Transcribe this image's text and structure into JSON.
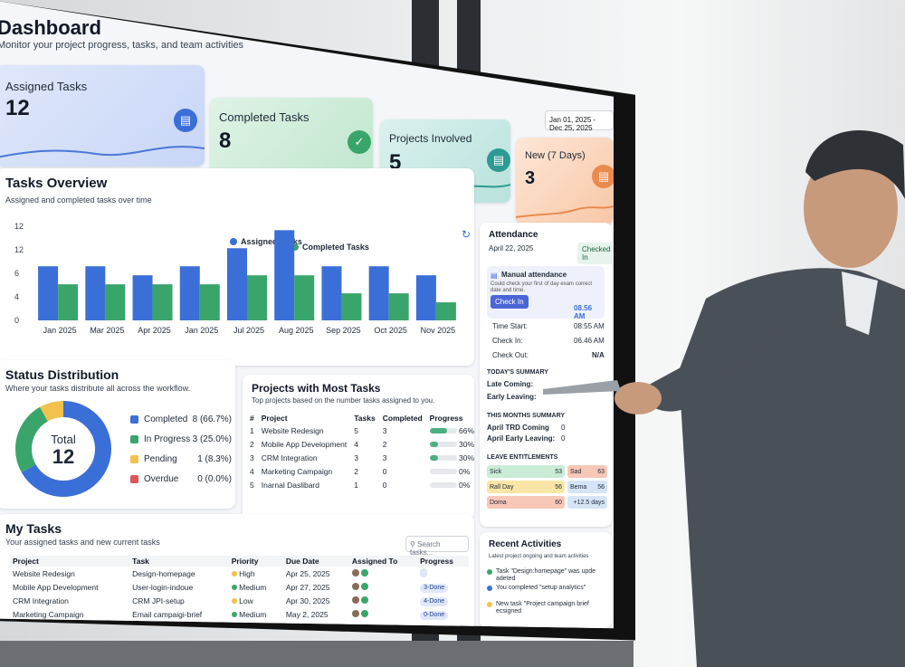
{
  "header": {
    "title": "Dashboard",
    "subtitle": "Monitor your project progress, tasks, and team activities",
    "date_range": "Jan 01, 2025 - Dec 25, 2025"
  },
  "stats": [
    {
      "label": "Assigned Tasks",
      "value": "12",
      "icon": "clipboard-icon",
      "color": "#3b6fd8"
    },
    {
      "label": "Completed Tasks",
      "value": "8",
      "icon": "check-icon",
      "color": "#3aa56a"
    },
    {
      "label": "Projects Involved",
      "value": "5",
      "icon": "document-icon",
      "color": "#2e9a92"
    },
    {
      "label": "New (7 Days)",
      "value": "3",
      "icon": "clipboard-icon",
      "color": "#e98a4e"
    }
  ],
  "overview": {
    "title": "Tasks Overview",
    "subtitle": "Assigned and completed tasks over time",
    "refresh_icon": "refresh-icon"
  },
  "chart_data": {
    "type": "bar",
    "categories": [
      "Jan 2025",
      "Mar 2025",
      "Apr 2025",
      "Jan 2025",
      "Jul 2025",
      "Aug 2025",
      "Sep 2025",
      "Oct 2025",
      "Nov 2025"
    ],
    "series": [
      {
        "name": "Assigned Tasks",
        "values": [
          6,
          6,
          5,
          6,
          8,
          10,
          6,
          6,
          5
        ],
        "color": "#3b6fd8"
      },
      {
        "name": "Completed Tasks",
        "values": [
          4,
          4,
          4,
          4,
          5,
          5,
          3,
          3,
          2
        ],
        "color": "#3aa56a"
      }
    ],
    "y_ticks": [
      "12",
      "12",
      "6",
      "4",
      "0"
    ],
    "ylim": [
      0,
      12
    ],
    "legend_position": "top"
  },
  "attendance": {
    "title": "Attendance",
    "date": "April 22, 2025",
    "status_badge": "Checked In",
    "manual_title": "Manual attendance",
    "manual_desc": "Could check your first of day exam correct date and time.",
    "checkin_btn": "Check In",
    "manual_time": "08.56 AM",
    "rows": [
      {
        "label": "Time Start:",
        "value": "08:55 AM"
      },
      {
        "label": "Check In:",
        "value": "06.46 AM"
      },
      {
        "label": "Check Out:",
        "value": "N/A"
      }
    ],
    "today_title": "TODAY'S SUMMARY",
    "today": [
      {
        "label": "Late Coming:"
      },
      {
        "label": "Early Leaving:"
      }
    ],
    "month_title": "THIS MONTHS SUMMARY",
    "month": [
      {
        "label": "April TRD Coming",
        "value": "0"
      },
      {
        "label": "April Early Leaving:",
        "value": "0"
      }
    ],
    "leave_title": "LEAVE ENTITLEMENTS",
    "leaves": [
      {
        "label": "Sick",
        "value": "53",
        "color": "#c9ecd6"
      },
      {
        "label": "Sad",
        "value": "63",
        "color": "#f7c7b8"
      },
      {
        "label": "Rall Day",
        "value": "56",
        "color": "#f9e6a6"
      },
      {
        "label": "Bema",
        "value": "56",
        "color": "#d6e4f8"
      },
      {
        "label": "Doma",
        "value": "60",
        "color": "#f7c7b8"
      },
      {
        "label": "",
        "value": "+12.5 days",
        "color": "#d6e4f8"
      }
    ]
  },
  "status": {
    "title": "Status Distribution",
    "subtitle": "Where your tasks distribute all across the workflow.",
    "total_label": "Total",
    "total_value": "12",
    "items": [
      {
        "label": "Completed",
        "value": "8 (66.7%)",
        "color": "#3b6fd8",
        "fraction": 0.667
      },
      {
        "label": "In Progress",
        "value": "3 (25.0%)",
        "color": "#3aa56a",
        "fraction": 0.25
      },
      {
        "label": "Pending",
        "value": "1 (8.3%)",
        "color": "#f2c14e",
        "fraction": 0.083
      },
      {
        "label": "Overdue",
        "value": "0 (0.0%)",
        "color": "#e05555",
        "fraction": 0.0
      }
    ]
  },
  "projects": {
    "title": "Projects with Most Tasks",
    "subtitle": "Top projects based on the number tasks assigned to you.",
    "headers": [
      "#",
      "Project",
      "Tasks",
      "Completed",
      "Progress"
    ],
    "rows": [
      {
        "n": "1",
        "name": "Website Redesign",
        "tasks": "5",
        "completed": "3",
        "progress": "66%",
        "fraction": 0.66
      },
      {
        "n": "2",
        "name": "Mobile App Development",
        "tasks": "4",
        "completed": "2",
        "progress": "30%",
        "fraction": 0.3
      },
      {
        "n": "3",
        "name": "CRM Integration",
        "tasks": "3",
        "completed": "3",
        "progress": "30%",
        "fraction": 0.3
      },
      {
        "n": "4",
        "name": "Marketing Campaign",
        "tasks": "2",
        "completed": "0",
        "progress": "0%",
        "fraction": 0
      },
      {
        "n": "5",
        "name": "Inarnal Daslibard",
        "tasks": "1",
        "completed": "0",
        "progress": "0%",
        "fraction": 0
      }
    ]
  },
  "mytasks": {
    "title": "My Tasks",
    "subtitle": "Your assigned tasks and new current tasks",
    "search_placeholder": "Search tasks...",
    "headers": [
      "Project",
      "Task",
      "Priority",
      "Due Date",
      "Assigned To",
      "Progress"
    ],
    "rows": [
      {
        "project": "Website Redesign",
        "task": "Design-homepage",
        "priority": "High",
        "pcolor": "#f2c14e",
        "due": "Apr 25, 2025",
        "progress_label": ""
      },
      {
        "project": "Mobile App Development",
        "task": "User-login-indoue",
        "priority": "Medium",
        "pcolor": "#3aa56a",
        "due": "Apr 27, 2025",
        "progress_label": "3-Done"
      },
      {
        "project": "CRM Integration",
        "task": "CRM JPI-setup",
        "priority": "Low",
        "pcolor": "#f2c14e",
        "due": "Apr 30, 2025",
        "progress_label": "4-Done"
      },
      {
        "project": "Marketing Campaign",
        "task": "Email campaigi-brief",
        "priority": "Medium",
        "pcolor": "#3aa56a",
        "due": "May 2, 2025",
        "progress_label": "0-Done"
      }
    ]
  },
  "activities": {
    "title": "Recent Activities",
    "subtitle": "Latest project ongoing and team activities",
    "items": [
      {
        "text": "Task \"Design:homepage\" was upde adeted",
        "color": "#3aa56a"
      },
      {
        "text": "You completed \"setup analytics\"",
        "color": "#3b6fd8"
      },
      {
        "text": "New task \"Project campaign brief ecsigned",
        "color": "#f2c14e"
      }
    ]
  }
}
